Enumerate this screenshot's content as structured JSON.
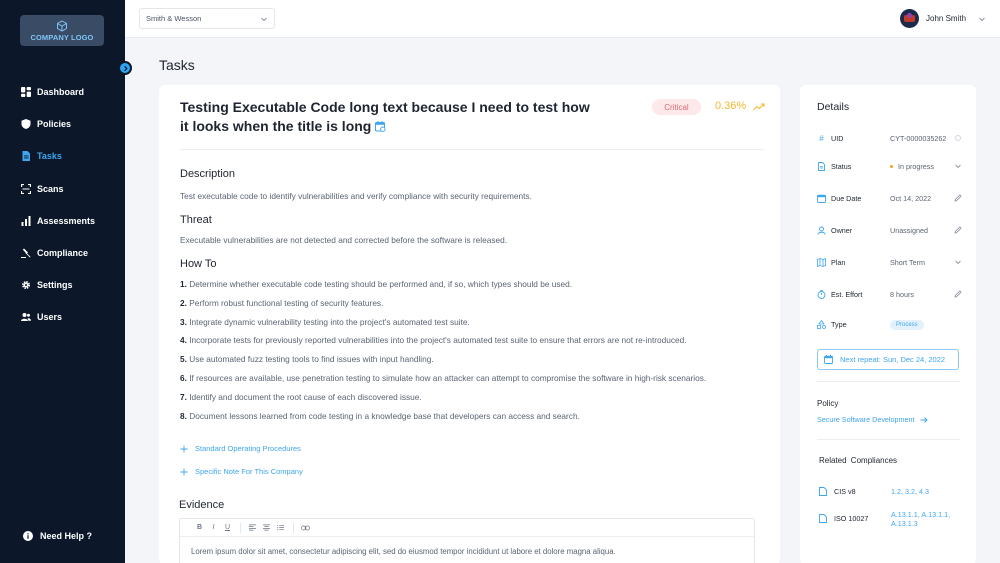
{
  "sidebar": {
    "logo_text": "COMPANY LOGO",
    "items": [
      {
        "label": "Dashboard",
        "icon": "dashboard-icon"
      },
      {
        "label": "Policies",
        "icon": "shield-icon"
      },
      {
        "label": "Tasks",
        "icon": "tasks-icon",
        "active": true
      },
      {
        "label": "Scans",
        "icon": "scan-icon"
      },
      {
        "label": "Assessments",
        "icon": "bar-chart-icon"
      },
      {
        "label": "Compliance",
        "icon": "gavel-icon"
      },
      {
        "label": "Settings",
        "icon": "gear-icon"
      },
      {
        "label": "Users",
        "icon": "users-icon"
      }
    ],
    "help_label": "Need Help ?"
  },
  "topbar": {
    "company_value": "Smith & Wesson",
    "user_name": "John Smith"
  },
  "page": {
    "title": "Tasks"
  },
  "task": {
    "title": "Testing Executable Code long text because I need to test how it looks when the title is long",
    "severity": "Critical",
    "score": "0.36%",
    "description_h": "Description",
    "description": "Test executable code to identify vulnerabilities and verify compliance with security requirements.",
    "threat_h": "Threat",
    "threat": "Executable vulnerabilities are not detected and corrected before the software is released.",
    "howto_h": "How To",
    "steps": [
      {
        "num": "1.",
        "text": "Determine whether executable code testing should be performed and, if so, which types should be used."
      },
      {
        "num": "2.",
        "text": "Perform robust functional testing of security features."
      },
      {
        "num": "3.",
        "text": "Integrate dynamic vulnerability testing into the project's automated test suite."
      },
      {
        "num": "4.",
        "text": "Incorporate tests for previously reported vulnerabilities into the project's automated test suite to ensure that errors are not re-introduced."
      },
      {
        "num": "5.",
        "text": "Use automated fuzz testing tools to find issues with input handling."
      },
      {
        "num": "6.",
        "text": "If resources are available, use penetration testing to simulate how an attacker can attempt to compromise the software in high-risk scenarios."
      },
      {
        "num": "7.",
        "text": "Identify and document the root cause of each discovered issue."
      },
      {
        "num": "8.",
        "text": "Document lessons learned from code testing in a knowledge base that developers can access and search."
      }
    ],
    "add_sop": "Standard Operating Procedures",
    "add_note": "Specific Note For This Company",
    "evidence_h": "Evidence",
    "editor_toolbar": {
      "bold": "B",
      "italic": "I",
      "underline": "U"
    },
    "evidence_text": "Lorem ipsum dolor sit amet, consectetur adipiscing elit, sed do eiusmod tempor incididunt ut labore et dolore magna aliqua."
  },
  "details": {
    "heading": "Details",
    "uid_label": "UID",
    "uid_value": "CYT-0000035262",
    "status_label": "Status",
    "status_value": "In progress",
    "due_label": "Due Date",
    "due_value": "Oct 14, 2022",
    "owner_label": "Owner",
    "owner_value": "Unassigned",
    "plan_label": "Plan",
    "plan_value": "Short Term",
    "effort_label": "Est. Effort",
    "effort_value": "8 hours",
    "type_label": "Type",
    "type_value": "Process",
    "repeat": "Next repeat: Sun, Dec 24, 2022",
    "policy_h": "Policy",
    "policy_link": "Secure Software Development",
    "related_h": "Related Compliances",
    "compliances": [
      {
        "name": "CIS v8",
        "controls": "1.2, 3.2, 4.3"
      },
      {
        "name": "ISO 10027",
        "controls": "A.13.1.1, A.13.1.1, A.13.1.3"
      }
    ]
  },
  "colors": {
    "sidebar_bg": "#0c1829",
    "accent": "#3ea6ef",
    "critical": "#e26a76",
    "score": "#f5b731"
  }
}
